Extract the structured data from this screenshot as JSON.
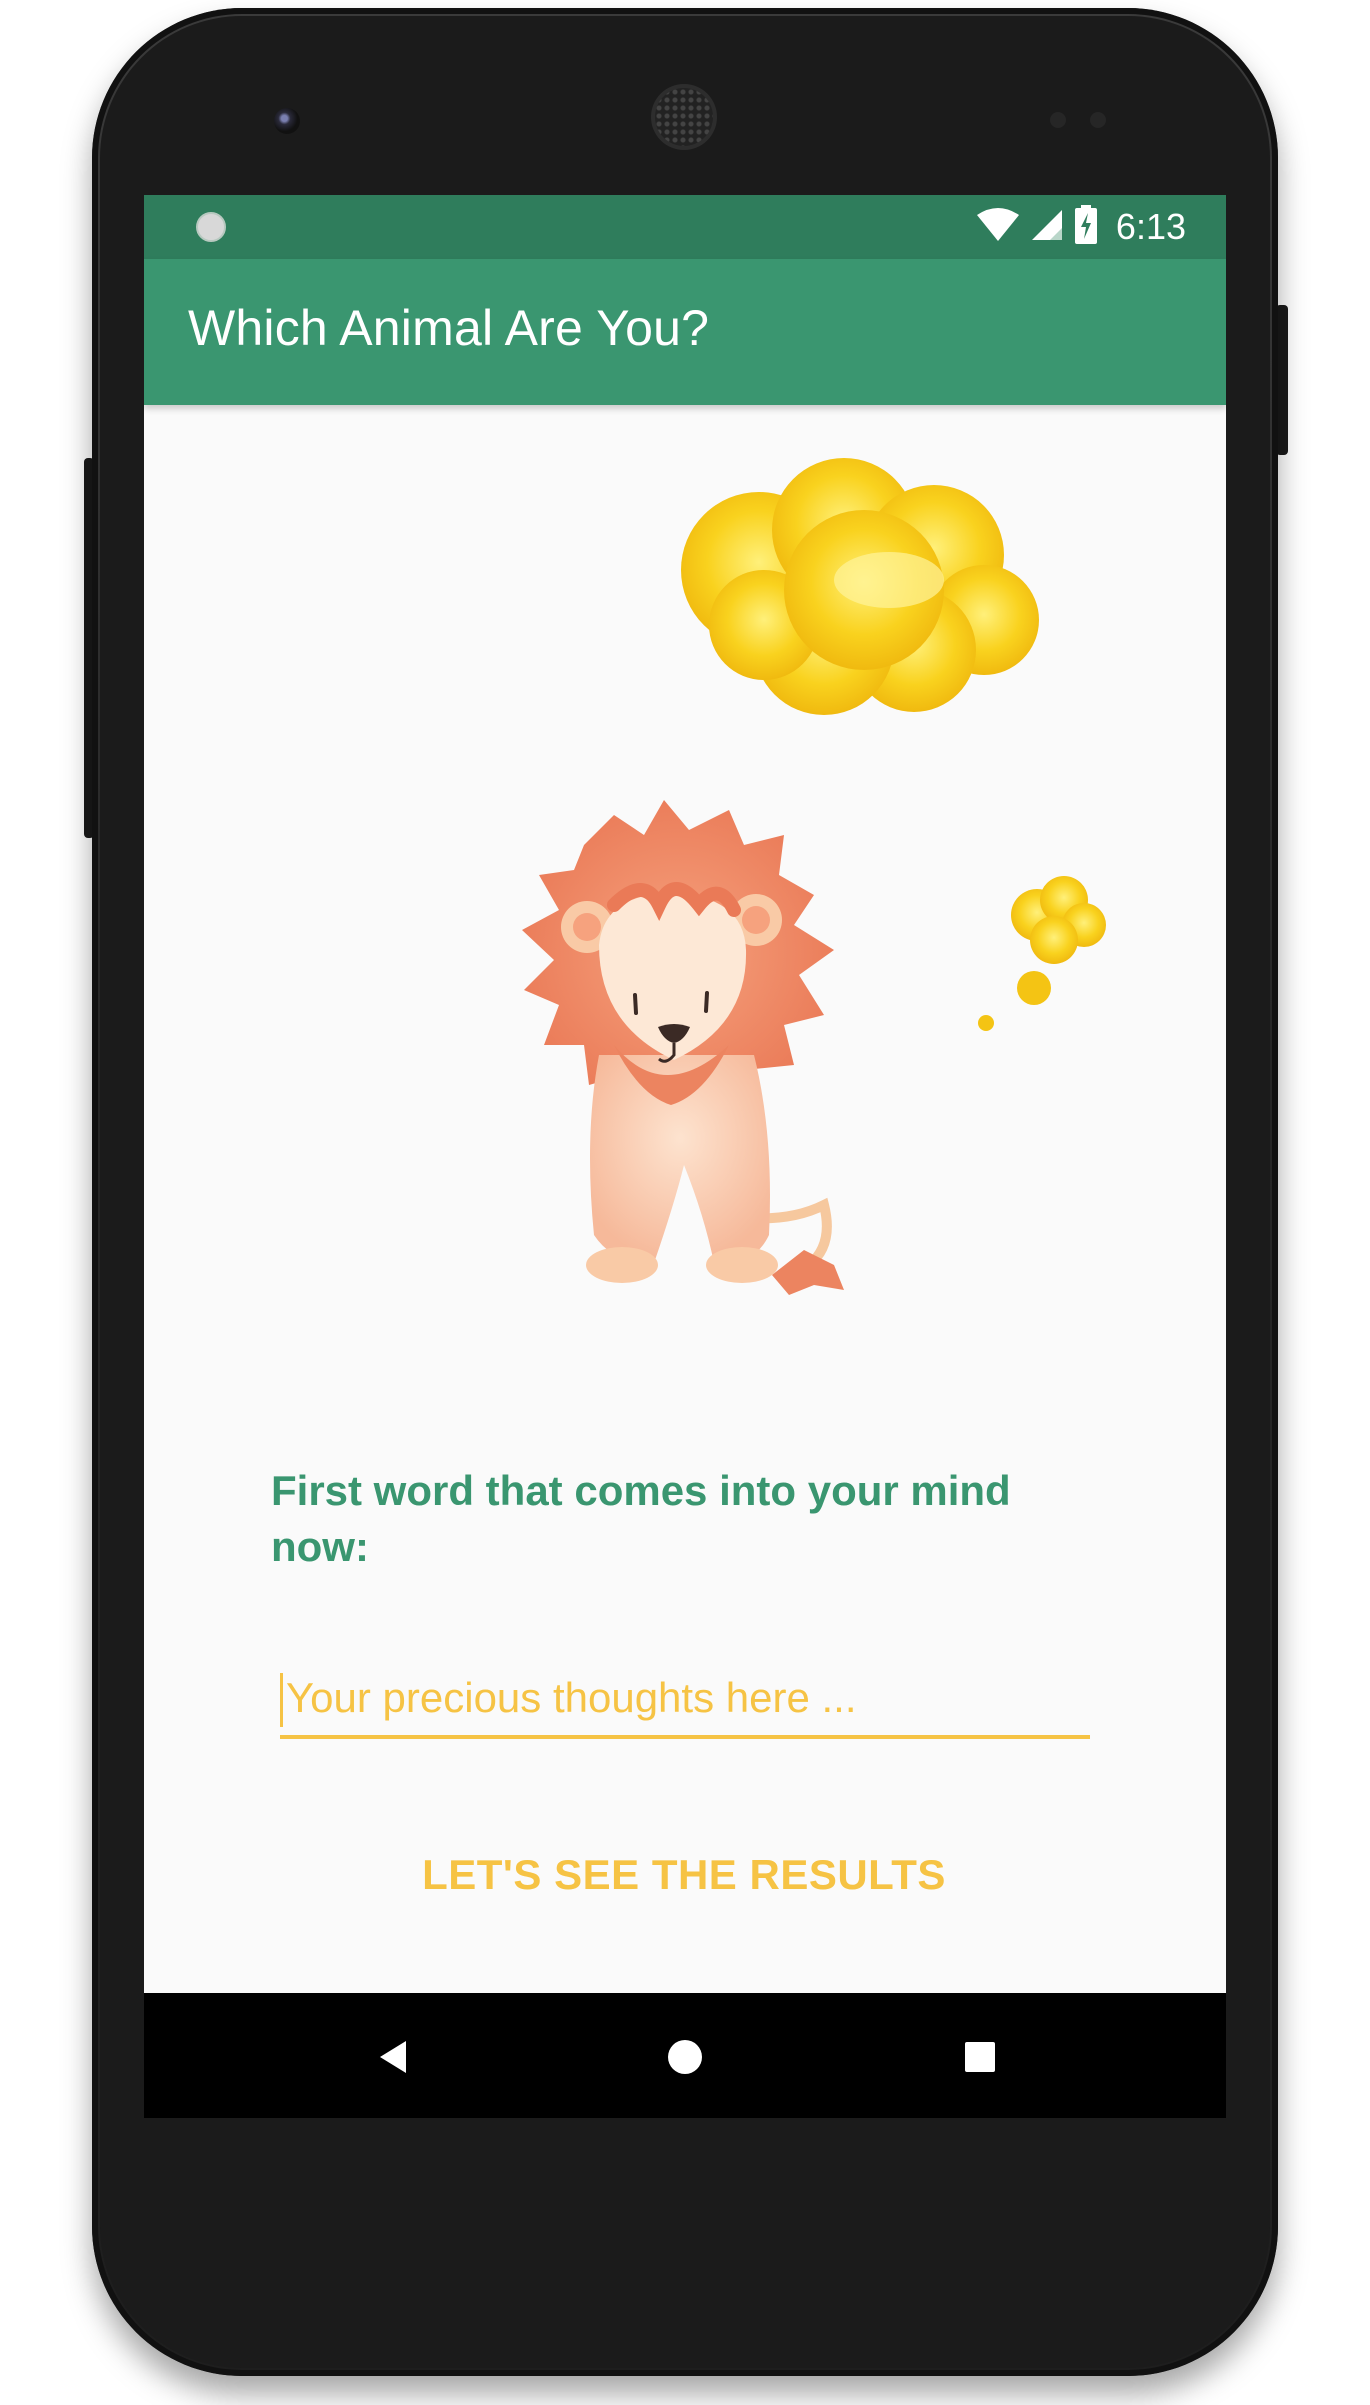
{
  "status_bar": {
    "time": "6:13",
    "icons": [
      "sync-icon",
      "wifi-icon",
      "signal-icon",
      "battery-charging-icon"
    ]
  },
  "app_bar": {
    "title": "Which Animal Are You?"
  },
  "illustration": {
    "subject": "lion-with-thought-bubble",
    "icons": [
      "thought-bubble-icon",
      "lion-illustration"
    ]
  },
  "question": {
    "prompt": "First word that comes into your mind now:"
  },
  "answer_input": {
    "placeholder": "Your precious thoughts here ...",
    "value": ""
  },
  "submit_button": {
    "label": "LET'S SEE THE RESULTS"
  },
  "navigation_bar": {
    "icons": [
      "back-icon",
      "home-icon",
      "recents-icon"
    ]
  },
  "colors": {
    "status_bar": "#2f7d5c",
    "app_bar": "#3a9670",
    "accent": "#f6c344",
    "prompt_text": "#3a9670",
    "background": "#fafafa"
  }
}
